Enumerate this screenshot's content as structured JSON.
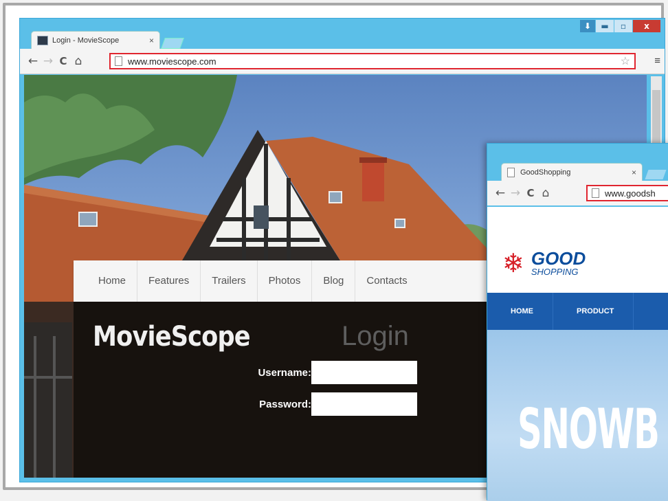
{
  "window_main": {
    "tab_title": "Login - MovieScope",
    "url": "www.moviescope.com",
    "site": {
      "nav": [
        "Home",
        "Features",
        "Trailers",
        "Photos",
        "Blog",
        "Contacts"
      ],
      "brand": "MovieScope",
      "login_title": "Login",
      "username_label": "Username:",
      "password_label": "Password:",
      "username_value": "",
      "password_value": ""
    }
  },
  "window_secondary": {
    "tab_title": "GoodShopping",
    "url": "www.goodsh",
    "site": {
      "logo_main": "GOOD",
      "logo_sub": "SHOPPING",
      "nav": [
        "HOME",
        "PRODUCT"
      ],
      "hero_text": "SNOWB"
    }
  },
  "glyphs": {
    "back": "←",
    "forward": "→",
    "reload": "C",
    "home": "⌂",
    "close_tab": "×",
    "star": "☆",
    "menu": "≡",
    "minimize": "▬",
    "maximize": "▫",
    "close_window": "x",
    "download": "⬇",
    "snowflake": "❄"
  },
  "colors": {
    "window_frame": "#5bbfe8",
    "address_highlight": "#e0252f",
    "close_button": "#c83b32",
    "shop_blue": "#1b5cac",
    "shop_red": "#d72028"
  }
}
